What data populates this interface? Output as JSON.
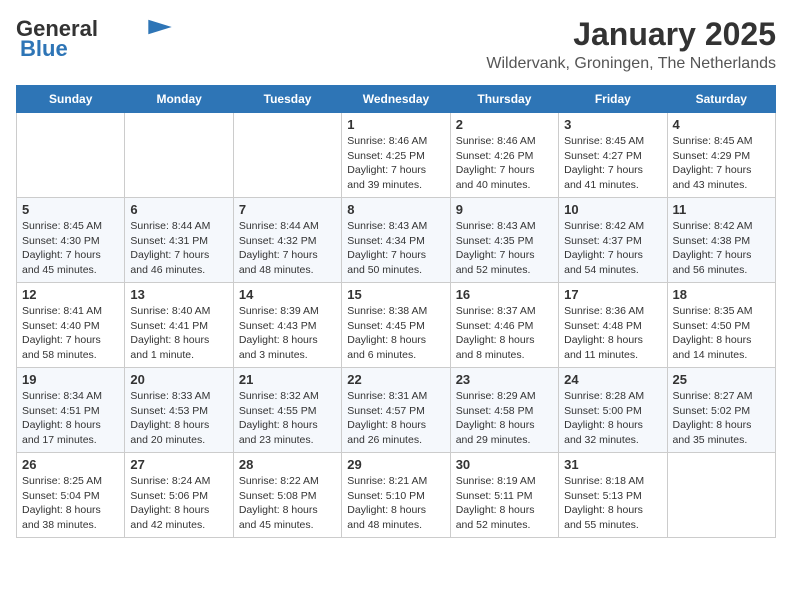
{
  "header": {
    "logo_general": "General",
    "logo_blue": "Blue",
    "month": "January 2025",
    "location": "Wildervank, Groningen, The Netherlands"
  },
  "days_of_week": [
    "Sunday",
    "Monday",
    "Tuesday",
    "Wednesday",
    "Thursday",
    "Friday",
    "Saturday"
  ],
  "weeks": [
    [
      {
        "day": "",
        "info": ""
      },
      {
        "day": "",
        "info": ""
      },
      {
        "day": "",
        "info": ""
      },
      {
        "day": "1",
        "info": "Sunrise: 8:46 AM\nSunset: 4:25 PM\nDaylight: 7 hours\nand 39 minutes."
      },
      {
        "day": "2",
        "info": "Sunrise: 8:46 AM\nSunset: 4:26 PM\nDaylight: 7 hours\nand 40 minutes."
      },
      {
        "day": "3",
        "info": "Sunrise: 8:45 AM\nSunset: 4:27 PM\nDaylight: 7 hours\nand 41 minutes."
      },
      {
        "day": "4",
        "info": "Sunrise: 8:45 AM\nSunset: 4:29 PM\nDaylight: 7 hours\nand 43 minutes."
      }
    ],
    [
      {
        "day": "5",
        "info": "Sunrise: 8:45 AM\nSunset: 4:30 PM\nDaylight: 7 hours\nand 45 minutes."
      },
      {
        "day": "6",
        "info": "Sunrise: 8:44 AM\nSunset: 4:31 PM\nDaylight: 7 hours\nand 46 minutes."
      },
      {
        "day": "7",
        "info": "Sunrise: 8:44 AM\nSunset: 4:32 PM\nDaylight: 7 hours\nand 48 minutes."
      },
      {
        "day": "8",
        "info": "Sunrise: 8:43 AM\nSunset: 4:34 PM\nDaylight: 7 hours\nand 50 minutes."
      },
      {
        "day": "9",
        "info": "Sunrise: 8:43 AM\nSunset: 4:35 PM\nDaylight: 7 hours\nand 52 minutes."
      },
      {
        "day": "10",
        "info": "Sunrise: 8:42 AM\nSunset: 4:37 PM\nDaylight: 7 hours\nand 54 minutes."
      },
      {
        "day": "11",
        "info": "Sunrise: 8:42 AM\nSunset: 4:38 PM\nDaylight: 7 hours\nand 56 minutes."
      }
    ],
    [
      {
        "day": "12",
        "info": "Sunrise: 8:41 AM\nSunset: 4:40 PM\nDaylight: 7 hours\nand 58 minutes."
      },
      {
        "day": "13",
        "info": "Sunrise: 8:40 AM\nSunset: 4:41 PM\nDaylight: 8 hours\nand 1 minute."
      },
      {
        "day": "14",
        "info": "Sunrise: 8:39 AM\nSunset: 4:43 PM\nDaylight: 8 hours\nand 3 minutes."
      },
      {
        "day": "15",
        "info": "Sunrise: 8:38 AM\nSunset: 4:45 PM\nDaylight: 8 hours\nand 6 minutes."
      },
      {
        "day": "16",
        "info": "Sunrise: 8:37 AM\nSunset: 4:46 PM\nDaylight: 8 hours\nand 8 minutes."
      },
      {
        "day": "17",
        "info": "Sunrise: 8:36 AM\nSunset: 4:48 PM\nDaylight: 8 hours\nand 11 minutes."
      },
      {
        "day": "18",
        "info": "Sunrise: 8:35 AM\nSunset: 4:50 PM\nDaylight: 8 hours\nand 14 minutes."
      }
    ],
    [
      {
        "day": "19",
        "info": "Sunrise: 8:34 AM\nSunset: 4:51 PM\nDaylight: 8 hours\nand 17 minutes."
      },
      {
        "day": "20",
        "info": "Sunrise: 8:33 AM\nSunset: 4:53 PM\nDaylight: 8 hours\nand 20 minutes."
      },
      {
        "day": "21",
        "info": "Sunrise: 8:32 AM\nSunset: 4:55 PM\nDaylight: 8 hours\nand 23 minutes."
      },
      {
        "day": "22",
        "info": "Sunrise: 8:31 AM\nSunset: 4:57 PM\nDaylight: 8 hours\nand 26 minutes."
      },
      {
        "day": "23",
        "info": "Sunrise: 8:29 AM\nSunset: 4:58 PM\nDaylight: 8 hours\nand 29 minutes."
      },
      {
        "day": "24",
        "info": "Sunrise: 8:28 AM\nSunset: 5:00 PM\nDaylight: 8 hours\nand 32 minutes."
      },
      {
        "day": "25",
        "info": "Sunrise: 8:27 AM\nSunset: 5:02 PM\nDaylight: 8 hours\nand 35 minutes."
      }
    ],
    [
      {
        "day": "26",
        "info": "Sunrise: 8:25 AM\nSunset: 5:04 PM\nDaylight: 8 hours\nand 38 minutes."
      },
      {
        "day": "27",
        "info": "Sunrise: 8:24 AM\nSunset: 5:06 PM\nDaylight: 8 hours\nand 42 minutes."
      },
      {
        "day": "28",
        "info": "Sunrise: 8:22 AM\nSunset: 5:08 PM\nDaylight: 8 hours\nand 45 minutes."
      },
      {
        "day": "29",
        "info": "Sunrise: 8:21 AM\nSunset: 5:10 PM\nDaylight: 8 hours\nand 48 minutes."
      },
      {
        "day": "30",
        "info": "Sunrise: 8:19 AM\nSunset: 5:11 PM\nDaylight: 8 hours\nand 52 minutes."
      },
      {
        "day": "31",
        "info": "Sunrise: 8:18 AM\nSunset: 5:13 PM\nDaylight: 8 hours\nand 55 minutes."
      },
      {
        "day": "",
        "info": ""
      }
    ]
  ]
}
